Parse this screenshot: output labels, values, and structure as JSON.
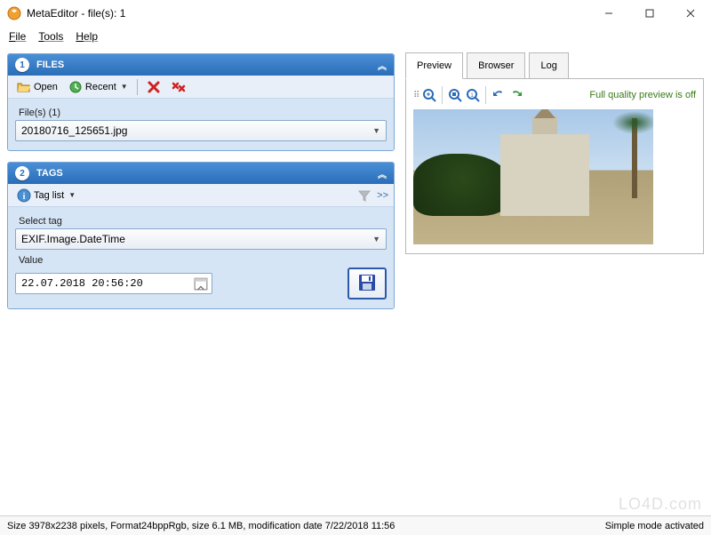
{
  "window": {
    "title": "MetaEditor - file(s): 1"
  },
  "menu": {
    "file": "File",
    "tools": "Tools",
    "help": "Help"
  },
  "panels": {
    "files": {
      "num": "1",
      "title": "FILES",
      "open": "Open",
      "recent": "Recent",
      "count_label": "File(s) (1)",
      "filename": "20180716_125651.jpg"
    },
    "tags": {
      "num": "2",
      "title": "TAGS",
      "taglist": "Tag list",
      "select_label": "Select tag",
      "tag_value": "EXIF.Image.DateTime",
      "value_label": "Value",
      "value": "22.07.2018 20:56:20"
    }
  },
  "tabs": {
    "preview": "Preview",
    "browser": "Browser",
    "log": "Log"
  },
  "preview": {
    "quality_text": "Full quality preview is off"
  },
  "status": {
    "left": "Size 3978x2238 pixels, Format24bppRgb, size 6.1 MB, modification date 7/22/2018 11:56",
    "right": "Simple mode activated"
  },
  "watermark": "LO4D.com"
}
